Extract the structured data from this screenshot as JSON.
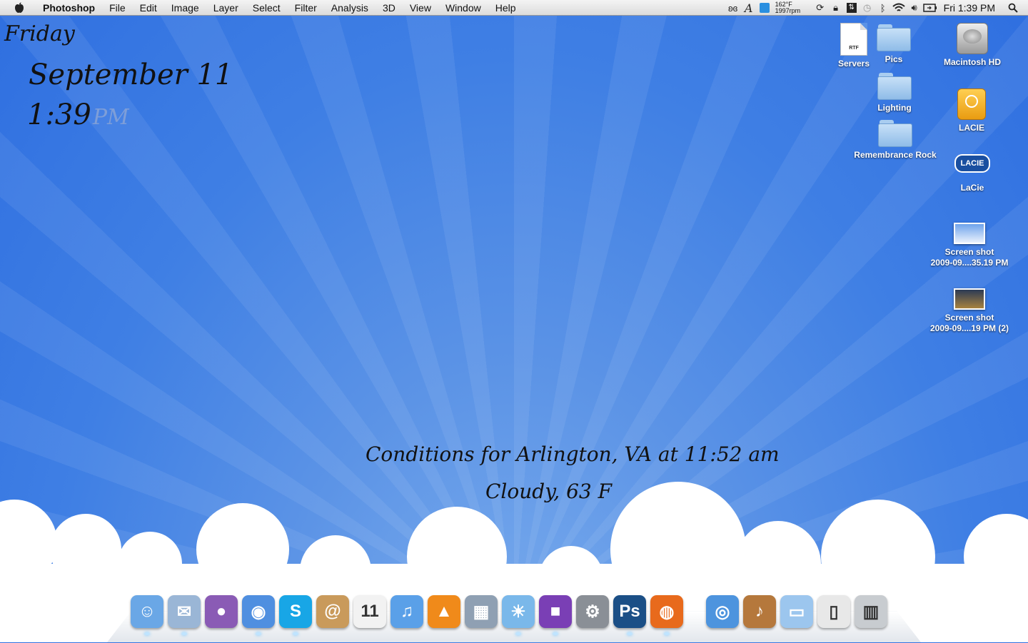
{
  "menubar": {
    "app_name": "Photoshop",
    "menus": [
      "File",
      "Edit",
      "Image",
      "Layer",
      "Select",
      "Filter",
      "Analysis",
      "3D",
      "View",
      "Window",
      "Help"
    ],
    "temp": "162°F",
    "rpm": "1997rpm",
    "clock": "Fri 1:39 PM",
    "status_icons": [
      "butterfly-icon",
      "font-icon",
      "app-status-icon",
      "sync-icon",
      "lock-icon",
      "upload-icon",
      "time-machine-icon",
      "bluetooth-icon",
      "wifi-icon",
      "volume-icon",
      "battery-icon",
      "spotlight-icon"
    ]
  },
  "widget": {
    "day": "Friday",
    "date": "September 11",
    "time": "1:39",
    "ampm": "PM"
  },
  "weather": {
    "line1": "Conditions for Arlington, VA at 11:52 am",
    "line2": "Cloudy, 63 F"
  },
  "desktop": {
    "servers": "Servers",
    "rtf": "RTF",
    "pics": "Pics",
    "lighting": "Lighting",
    "remembrance": "Remembrance Rock",
    "macintosh_hd": "Macintosh HD",
    "lacie_drive": "LACIE",
    "lacie_logo_text": "LACIE",
    "lacie": "LaCie",
    "shot1_line1": "Screen shot",
    "shot1_line2": "2009-09....35.19 PM",
    "shot2_line1": "Screen shot",
    "shot2_line2": "2009-09....19 PM (2)"
  },
  "dock": {
    "items": [
      {
        "icon": "finder-icon",
        "glyph": "☺",
        "color": "#6aa7e6",
        "running": true
      },
      {
        "icon": "mail-icon",
        "glyph": "✉",
        "color": "#9ab6d6",
        "running": true
      },
      {
        "icon": "adium-icon",
        "glyph": "●",
        "color": "#8a5bb5",
        "running": false
      },
      {
        "icon": "ichat-icon",
        "glyph": "◉",
        "color": "#4f8fe0",
        "running": true
      },
      {
        "icon": "skype-icon",
        "glyph": "S",
        "color": "#18a6e6",
        "running": true
      },
      {
        "icon": "address-book-icon",
        "glyph": "@",
        "color": "#c99a5b",
        "running": false
      },
      {
        "icon": "ical-icon",
        "glyph": "11",
        "color": "#f2f2f2",
        "running": false
      },
      {
        "icon": "itunes-icon",
        "glyph": "♫",
        "color": "#5aa0e8",
        "running": false
      },
      {
        "icon": "vlc-icon",
        "glyph": "▲",
        "color": "#f08a1a",
        "running": false
      },
      {
        "icon": "preview-icon",
        "glyph": "▦",
        "color": "#8fa0b3",
        "running": false
      },
      {
        "icon": "iphoto-icon",
        "glyph": "☀",
        "color": "#7ab8ea",
        "running": true
      },
      {
        "icon": "front-row-icon",
        "glyph": "■",
        "color": "#7a3fb5",
        "running": true
      },
      {
        "icon": "system-preferences-icon",
        "glyph": "⚙",
        "color": "#8a8f96",
        "running": false
      },
      {
        "icon": "photoshop-icon",
        "glyph": "Ps",
        "color": "#1b4f86",
        "running": true
      },
      {
        "icon": "firefox-icon",
        "glyph": "◍",
        "color": "#e86a1c",
        "running": true
      },
      {
        "icon": "disk-utility-icon",
        "glyph": "◎",
        "color": "#4d94de",
        "running": false
      },
      {
        "icon": "garageband-icon",
        "glyph": "♪",
        "color": "#b5783c",
        "running": false
      },
      {
        "icon": "folder-stack-icon",
        "glyph": "▭",
        "color": "#9cc6ee",
        "running": false
      },
      {
        "icon": "documents-stack-icon",
        "glyph": "▯",
        "color": "#e8e8e8",
        "running": false
      },
      {
        "icon": "trash-icon",
        "glyph": "▥",
        "color": "#c8ccd0",
        "running": false
      }
    ]
  }
}
